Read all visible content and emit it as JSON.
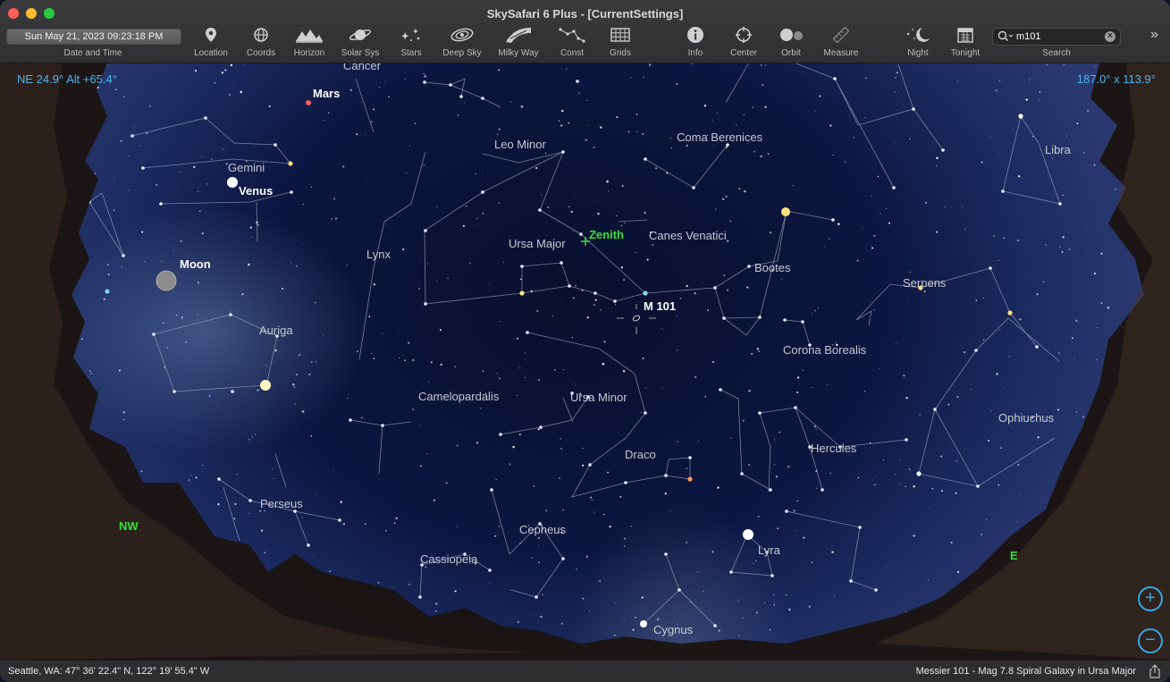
{
  "window": {
    "title": "SkySafari 6 Plus - [CurrentSettings]"
  },
  "toolbar": {
    "datetime_value": "Sun May 21, 2023  09:23:18 PM",
    "datetime_label": "Date and Time",
    "tools": [
      {
        "label": "Location",
        "icon": "location-pin-icon"
      },
      {
        "label": "Coords",
        "icon": "coords-icon"
      },
      {
        "label": "Horizon",
        "icon": "horizon-icon"
      },
      {
        "label": "Solar Sys",
        "icon": "planet-icon"
      },
      {
        "label": "Stars",
        "icon": "stars-icon"
      },
      {
        "label": "Deep Sky",
        "icon": "galaxy-icon"
      },
      {
        "label": "Milky Way",
        "icon": "milky-way-icon"
      },
      {
        "label": "Const",
        "icon": "constellation-icon"
      },
      {
        "label": "Grids",
        "icon": "grid-icon"
      },
      {
        "label": "Info",
        "icon": "info-icon"
      },
      {
        "label": "Center",
        "icon": "crosshair-icon"
      },
      {
        "label": "Orbit",
        "icon": "orbit-icon"
      },
      {
        "label": "Measure",
        "icon": "ruler-icon"
      },
      {
        "label": "Night",
        "icon": "moon-icon"
      },
      {
        "label": "Tonight",
        "icon": "calendar-icon"
      }
    ],
    "search": {
      "value": "m101",
      "label": "Search"
    },
    "more_icon": "double-chevron-icon"
  },
  "sky": {
    "hud_left": "NE 24.9° Alt +65.4°",
    "hud_right": "187.0° x 113.9°",
    "constellations": [
      "Cancer",
      "Leo Minor",
      "Coma Berenices",
      "Libra",
      "Gemini",
      "Lynx",
      "Ursa Major",
      "Canes Venatici",
      "Bootes",
      "Serpens",
      "Auriga",
      "Corona Borealis",
      "Camelopardalis",
      "Ursa Minor",
      "Ophiuchus",
      "Draco",
      "Hercules",
      "Perseus",
      "Cepheus",
      "Lyra",
      "Cassiopeia",
      "Cygnus"
    ],
    "objects": {
      "mars": "Mars",
      "venus": "Venus",
      "moon": "Moon",
      "m101": "M 101"
    },
    "markers": {
      "zenith": "Zenith",
      "nw": "NW",
      "e": "E"
    }
  },
  "status": {
    "location": "Seattle, WA: 47° 36' 22.4\" N, 122° 19' 55.4\" W",
    "selection": "Messier 101 - Mag 7.8 Spiral Galaxy in Ursa Major"
  },
  "colors": {
    "hud": "#4fb4f0",
    "zoom": "#35a7e0",
    "marker": "#33e033"
  }
}
